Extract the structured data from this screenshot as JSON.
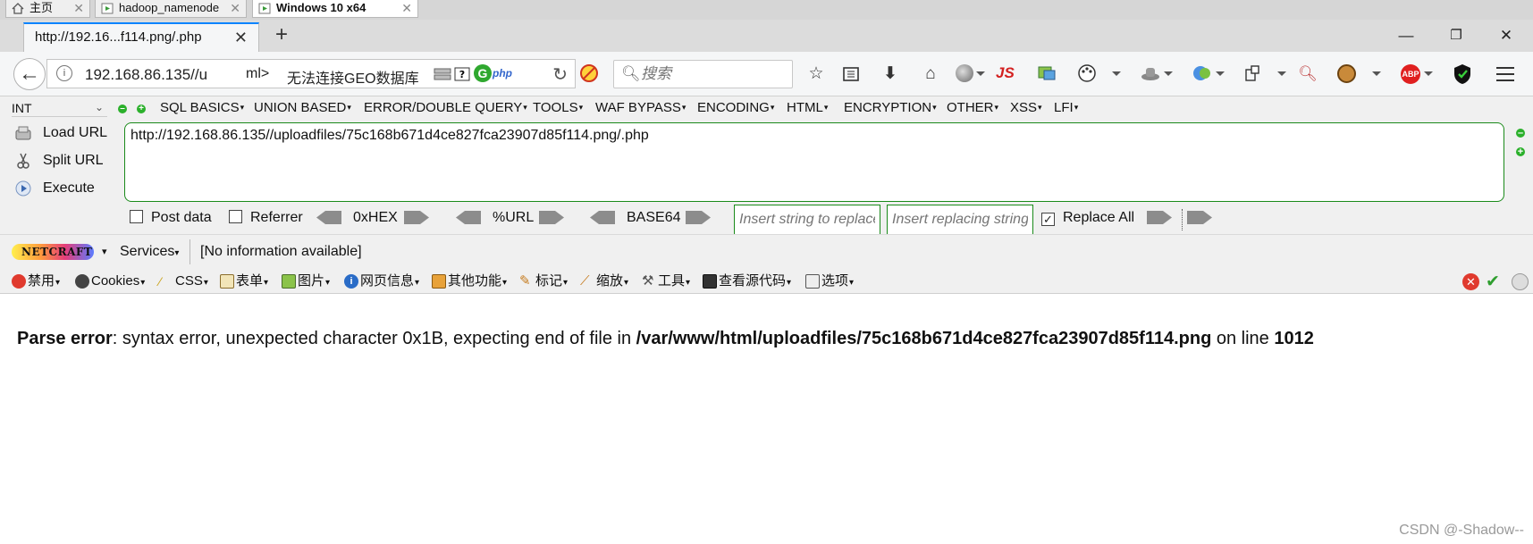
{
  "vm_tabs": [
    {
      "label": "主页"
    },
    {
      "label": "hadoop_namenode"
    },
    {
      "label": "Windows 10 x64"
    }
  ],
  "browser": {
    "tab_title": "http://192.16...f114.png/.php",
    "new_tab": "+",
    "window_controls": [
      "—",
      "❐",
      "✕"
    ],
    "address_visible": "192.168.86.135//u",
    "address_tail": "ml>",
    "geo_status": "无法连接GEO数据库",
    "php_badge": "php",
    "search_placeholder": "搜索",
    "addon_js": "JS",
    "addon_abp": "ABP"
  },
  "hackbar": {
    "type_select": "INT",
    "menus": [
      "SQL BASICS",
      "UNION BASED",
      "ERROR/DOUBLE QUERY",
      "TOOLS",
      "WAF BYPASS",
      "ENCODING",
      "HTML",
      "ENCRYPTION",
      "OTHER",
      "XSS",
      "LFI"
    ],
    "load_url": "Load URL",
    "split_url": "Split URL",
    "execute": "Execute",
    "url_value": "http://192.168.86.135//uploadfiles/75c168b671d4ce827fca23907d85f114.png/.php",
    "post_data": "Post data",
    "referrer": "Referrer",
    "hex": "0xHEX",
    "urlenc": "%URL",
    "base64": "BASE64",
    "insert_string_placeholder": "Insert string to replace",
    "insert_replacing_placeholder": "Insert replacing string",
    "replace_all": "Replace All",
    "replace_all_checked": true
  },
  "netcraft": {
    "logo": "NETCRAFT",
    "services": "Services",
    "info": "[No information available]"
  },
  "webdev": {
    "items": [
      "禁用",
      "Cookies",
      "CSS",
      "表单",
      "图片",
      "网页信息",
      "其他功能",
      "标记",
      "缩放",
      "工具",
      "查看源代码",
      "选项"
    ]
  },
  "page": {
    "error_label": "Parse error",
    "error_msg": ": syntax error, unexpected character 0x1B, expecting end of file in ",
    "error_path": "/var/www/html/uploadfiles/75c168b671d4ce827fca23907d85f114.png",
    "error_online": " on line ",
    "error_line": "1012"
  },
  "watermark": "CSDN @-Shadow--",
  "colors": {
    "accent_blue": "#0a84ff",
    "hackbar_green": "#1a8a1a",
    "close_red": "#e03a2e",
    "ok_green": "#2f9e2f"
  }
}
